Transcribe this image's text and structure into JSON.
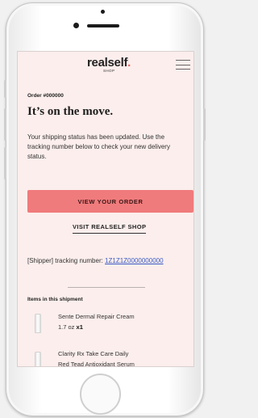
{
  "brand": {
    "name": "realself",
    "dot": ".",
    "sub": "SHOP",
    "accent": "#e8625f"
  },
  "order": {
    "number": "Order #000000",
    "headline": "It’s on the move.",
    "intro": "Your shipping status has been updated. Use the tracking number below to check your new delivery status.",
    "view_button": "VIEW YOUR ORDER",
    "visit_link": "VISIT REALSELF SHOP",
    "tracking_label": "[Shipper] tracking number: ",
    "tracking_number": "1Z1Z1Z0000000000",
    "items_title": "Items in this shipment"
  },
  "items": [
    {
      "name": "Sente Dermal Repair Cream",
      "size": "1.7 oz",
      "qty": "x1"
    },
    {
      "name": "Clarity Rx Take Care Daily",
      "line2": "Red Tead Antioxidant Serum"
    }
  ],
  "colors": {
    "screen_bg": "#fbeeec",
    "button": "#f07b7c",
    "link": "#3a59c4"
  }
}
